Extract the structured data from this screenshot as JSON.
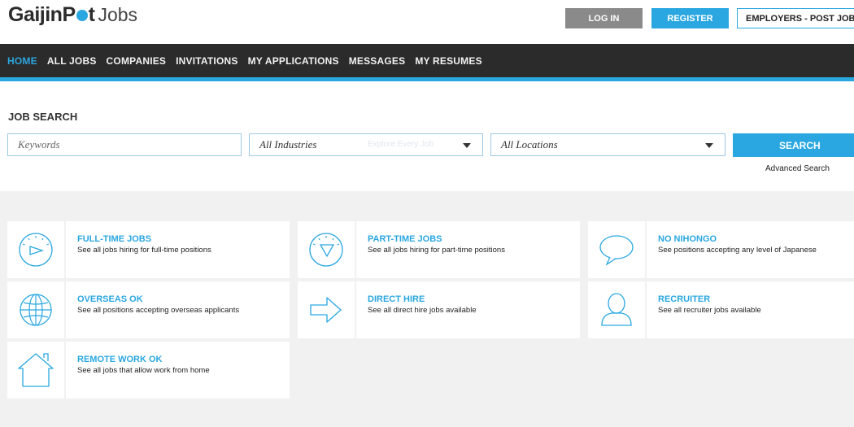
{
  "header": {
    "logo_main": "GaijinP",
    "logo_main_end": "t",
    "logo_sub": "Jobs",
    "login_label": "LOG IN",
    "register_label": "REGISTER",
    "employers_label": "EMPLOYERS - POST JOB"
  },
  "nav": {
    "items": [
      {
        "label": "HOME",
        "active": true
      },
      {
        "label": "ALL JOBS"
      },
      {
        "label": "COMPANIES"
      },
      {
        "label": "INVITATIONS"
      },
      {
        "label": "MY APPLICATIONS"
      },
      {
        "label": "MESSAGES"
      },
      {
        "label": "MY RESUMES"
      }
    ]
  },
  "search": {
    "title": "JOB SEARCH",
    "keywords_placeholder": "Keywords",
    "industries_value": "All Industries",
    "industries_ghost": "Explore Every Job",
    "locations_value": "All Locations",
    "search_label": "SEARCH",
    "advanced_label": "Advanced Search"
  },
  "categories": [
    {
      "icon": "clock-icon",
      "title": "FULL-TIME JOBS",
      "desc": "See all jobs hiring for full-time positions"
    },
    {
      "icon": "half-clock-icon",
      "title": "PART-TIME JOBS",
      "desc": "See all jobs hiring for part-time positions"
    },
    {
      "icon": "speech-bubble-icon",
      "title": "NO NIHONGO",
      "desc": "See positions accepting any level of Japanese"
    },
    {
      "icon": "globe-icon",
      "title": "OVERSEAS OK",
      "desc": "See all positions accepting overseas applicants"
    },
    {
      "icon": "arrow-right-icon",
      "title": "DIRECT HIRE",
      "desc": "See all direct hire jobs available"
    },
    {
      "icon": "person-icon",
      "title": "RECRUITER",
      "desc": "See all recruiter jobs available"
    },
    {
      "icon": "house-icon",
      "title": "REMOTE WORK OK",
      "desc": "See all jobs that allow work from home"
    }
  ],
  "colors": {
    "accent": "#2aa7e0",
    "nav_bg": "#2b2b2b",
    "grid_bg": "#f1f1f1",
    "login_bg": "#8a8a8a"
  }
}
